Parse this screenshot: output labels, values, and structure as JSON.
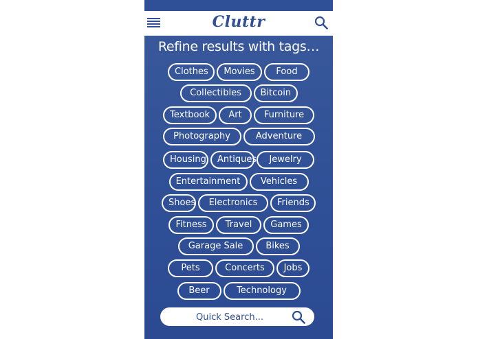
{
  "header": {
    "logo": "Cluttr",
    "menu_icon": "hamburger-menu-icon",
    "search_icon": "search-icon"
  },
  "title": "Refine results with tags…",
  "tag_rows": [
    [
      "Clothes",
      "Movies",
      "Food"
    ],
    [
      "Collectibles",
      "Bitcoin"
    ],
    [
      "Textbook",
      "Art",
      "Furniture"
    ],
    [
      "Photography",
      "Adventure"
    ],
    [
      "Housing",
      "Antiques",
      "Jewelry"
    ],
    [
      "Entertainment",
      "Vehicles"
    ],
    [
      "Shoes",
      "Electronics",
      "Friends"
    ],
    [
      "Fitness",
      "Travel",
      "Games"
    ],
    [
      "Garage Sale",
      "Bikes"
    ],
    [
      "Pets",
      "Concerts",
      "Jobs"
    ],
    [
      "Beer",
      "Technology"
    ]
  ],
  "quick_search": {
    "placeholder": "Quick Search..."
  },
  "colors": {
    "brand_blue": "#2f4f96",
    "white": "#ffffff"
  }
}
